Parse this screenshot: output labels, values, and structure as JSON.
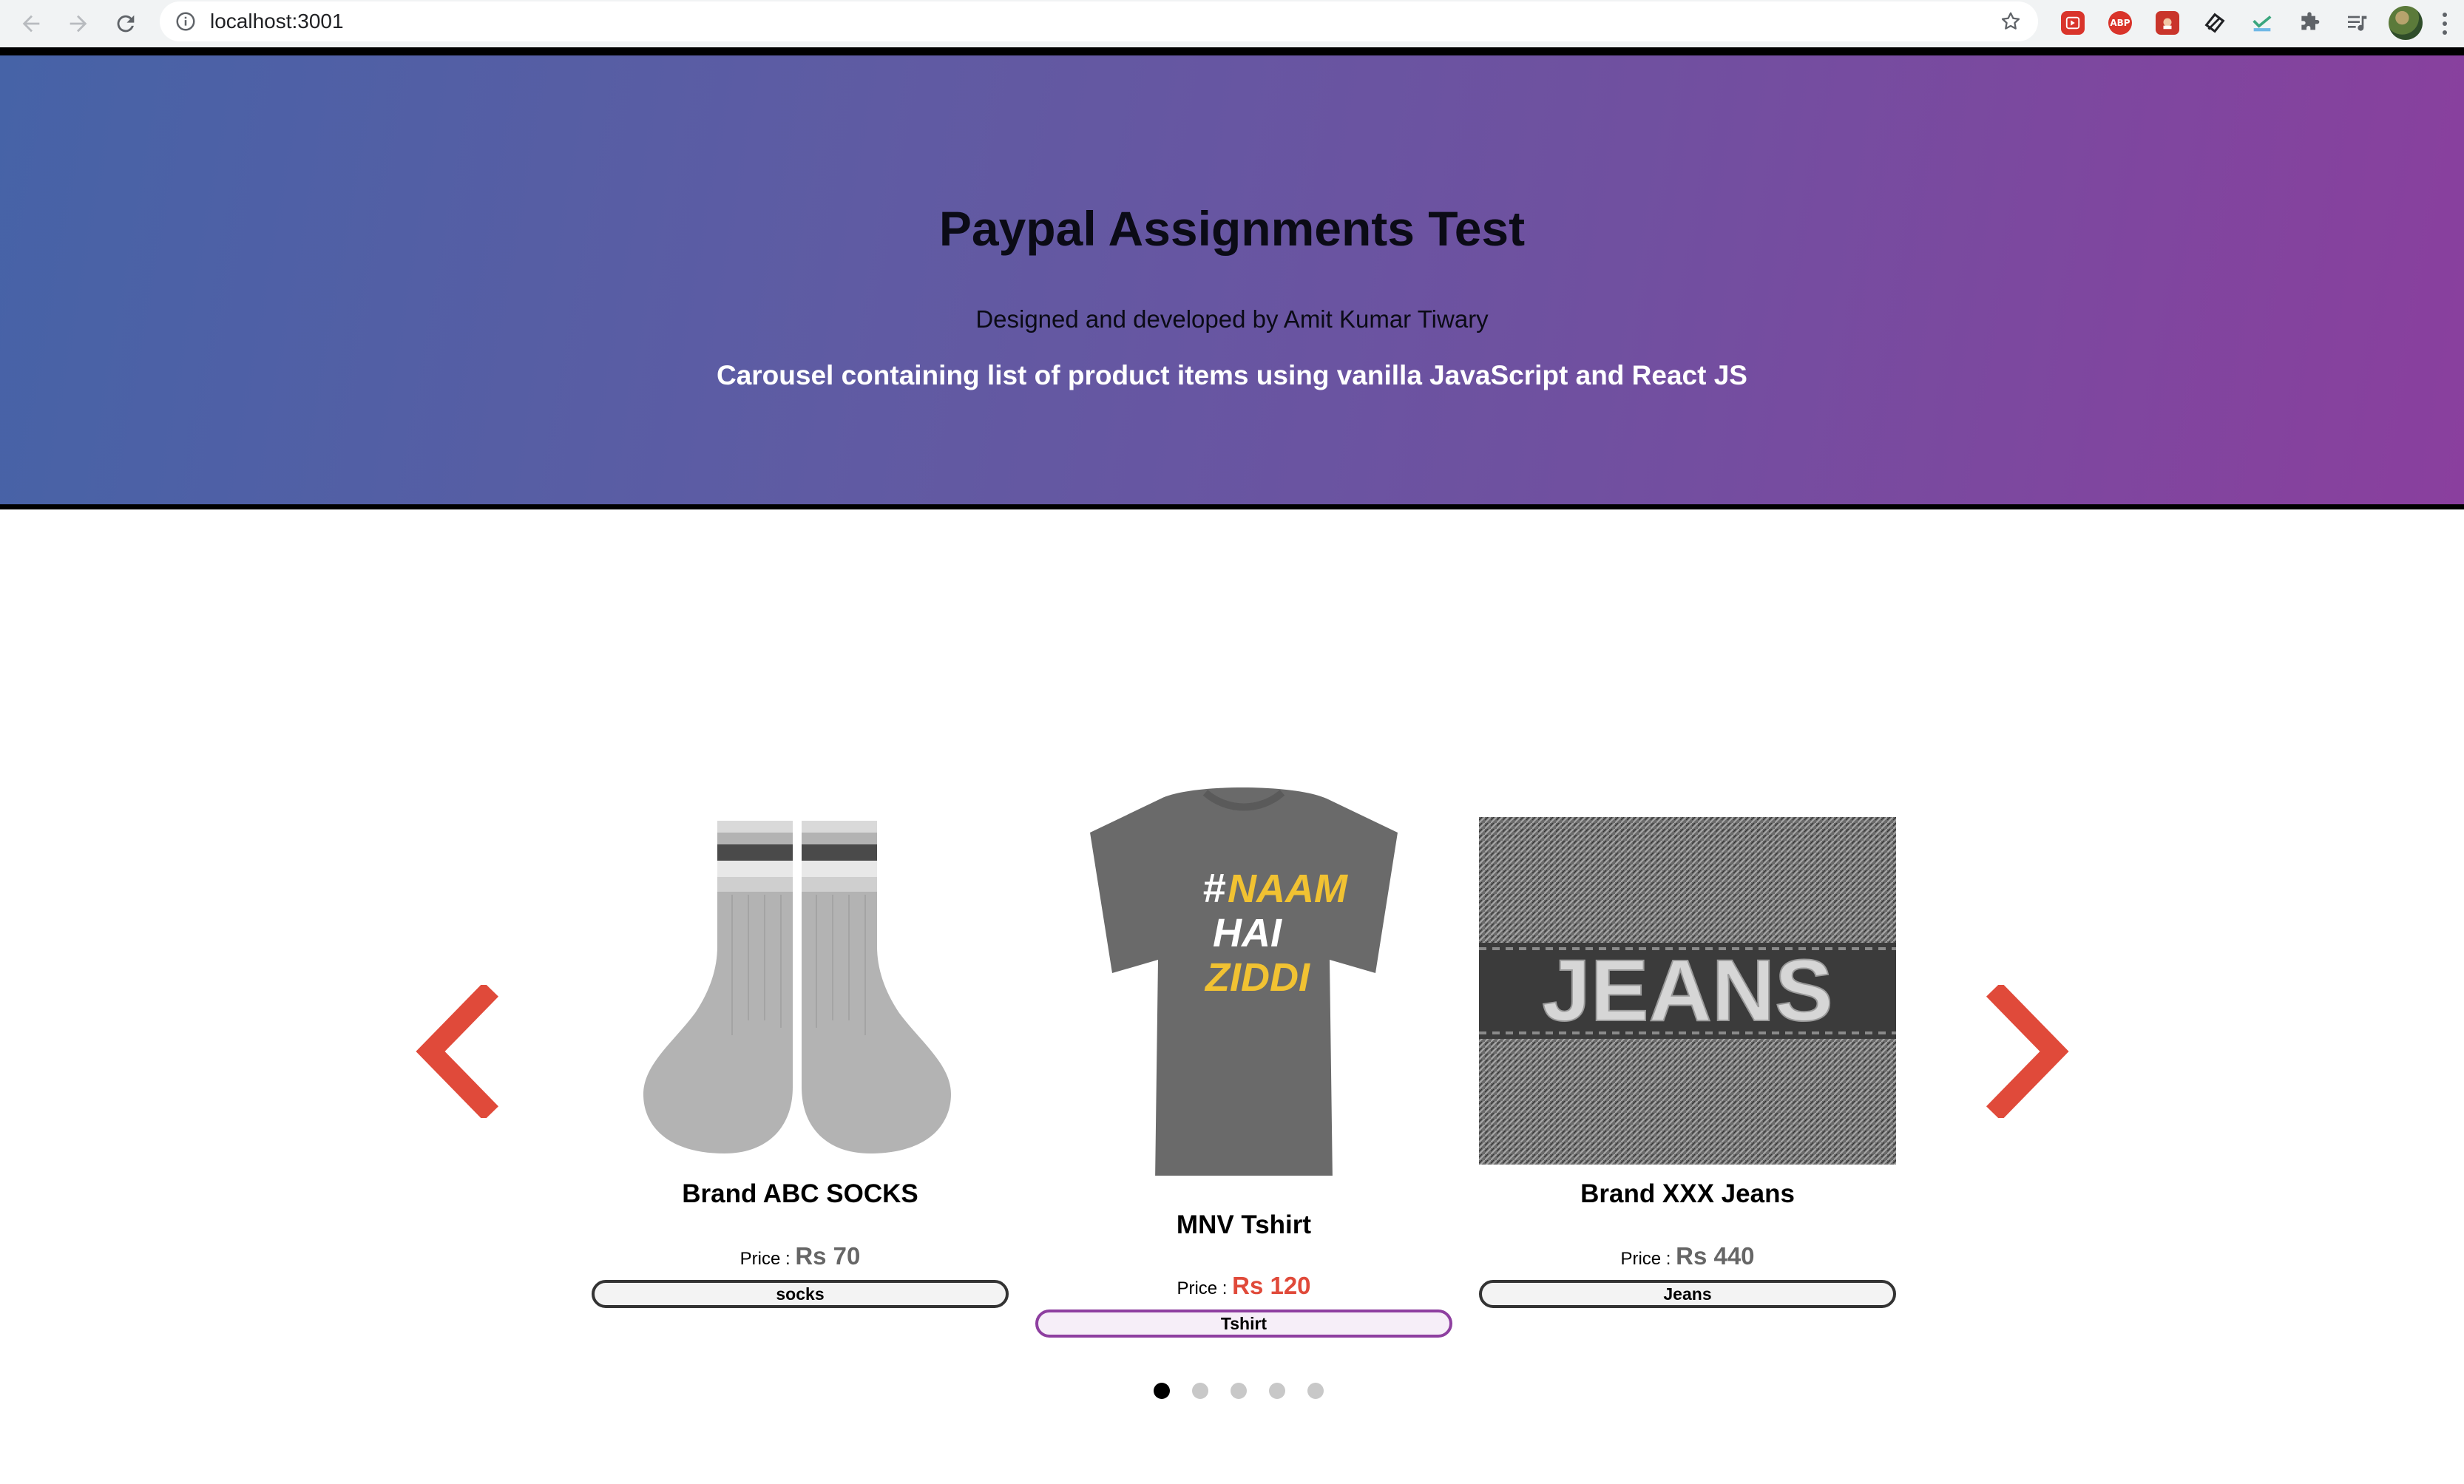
{
  "browser": {
    "url": "localhost:3001",
    "extensions": [
      "video-ext-icon",
      "adblock-plus-icon",
      "photo-ext-icon",
      "tag-ext-icon",
      "check-ext-icon",
      "puzzle-icon",
      "media-queue-icon"
    ],
    "abp_label": "ABP"
  },
  "header": {
    "title": "Paypal Assignments Test",
    "credit": "Designed and developed by Amit Kumar Tiwary",
    "description": "Carousel containing list of product items using vanilla JavaScript and React JS",
    "colors": {
      "gradient_start": "#4663a7",
      "gradient_end": "#8a3f9e"
    }
  },
  "carousel": {
    "arrow_color": "#e04a3a",
    "items": [
      {
        "name": "Brand ABC SOCKS",
        "price_label": "Price :",
        "price": "Rs 70",
        "tag": "socks",
        "image": "socks-image",
        "active": false
      },
      {
        "name": "MNV Tshirt",
        "price_label": "Price :",
        "price": "Rs 120",
        "tag": "Tshirt",
        "image": "tshirt-image",
        "active": true,
        "shirt_text": [
          "#",
          "NAAM",
          "HAI",
          "ZIDDI"
        ]
      },
      {
        "name": "Brand XXX Jeans",
        "price_label": "Price :",
        "price": "Rs 440",
        "tag": "Jeans",
        "image": "jeans-image",
        "active": false,
        "label_text": "JEANS"
      }
    ],
    "pagination": {
      "total": 5,
      "active_index": 0
    }
  }
}
